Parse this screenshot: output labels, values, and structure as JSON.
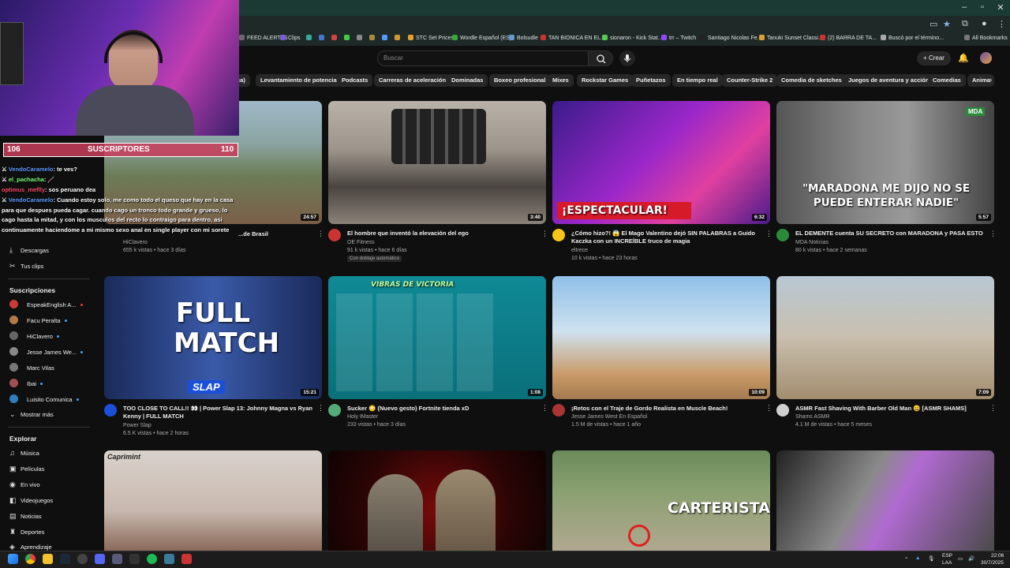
{
  "browser": {
    "bookmarks": [
      "FEED ALERTAS",
      "Clips",
      "STC Set Prices",
      "Wordle Español (ES)",
      "Bolsudle",
      "TAN BIONICA EN EL...",
      "sionaron - Kick Stat...",
      "trr – Twitch",
      "Santiago Nicolas Fe...",
      "Tanuki Sunset Classi...",
      "(2) BARRA DE TA...",
      "Buscó por el término...",
      "All Bookmarks"
    ]
  },
  "header": {
    "search_placeholder": "Buscar",
    "create_label": "Crear"
  },
  "chips": [
    "Levantamiento de potencia",
    "Podcasts",
    "Carreras de aceleración",
    "Dominadas",
    "Boxeo profesional",
    "Mixes",
    "Rockstar Games",
    "Puñetazos",
    "En tiempo real",
    "Counter-Strike 2",
    "Comedia de sketches",
    "Juegos de aventura y acción",
    "Comedias",
    "Anima"
  ],
  "sidebar": {
    "top_items": [
      {
        "label": "Descargas"
      },
      {
        "label": "Tus clips"
      }
    ],
    "subs_heading": "Suscripciones",
    "subs": [
      {
        "label": "EspeakEnglish A...",
        "color": "#c83a3a"
      },
      {
        "label": "Facu Peralta",
        "color": "#b07a4a"
      },
      {
        "label": "HiClavero",
        "color": "#666"
      },
      {
        "label": "Jesse James We...",
        "color": "#888"
      },
      {
        "label": "Marc Vilas",
        "color": "#777"
      },
      {
        "label": "Ibai",
        "color": "#a05050"
      },
      {
        "label": "Luisito Comunica",
        "color": "#2f7fbf"
      }
    ],
    "show_more": "Mostrar más",
    "explore_heading": "Explorar",
    "explore": [
      {
        "label": "Música",
        "icon": "♫"
      },
      {
        "label": "Películas",
        "icon": "▣"
      },
      {
        "label": "En vivo",
        "icon": "◉"
      },
      {
        "label": "Videojuegos",
        "icon": "◧"
      },
      {
        "label": "Noticias",
        "icon": "▤"
      },
      {
        "label": "Deportes",
        "icon": "♜"
      },
      {
        "label": "Aprendizaje",
        "icon": "◈"
      }
    ]
  },
  "videos": [
    {
      "title": "...de Brasil",
      "channel": "HiClavero",
      "meta": "655 k vistas • hace 3 días",
      "duration": "24:57"
    },
    {
      "title": "El hombre que inventó la elevación del ego",
      "channel": "OE Fitness",
      "meta": "91 k vistas • hace 6 días",
      "badge": "Con doblaje automático",
      "duration": "3:40"
    },
    {
      "title": "¿Cómo hizo?! 😱 El Mago Valentino dejó SIN PALABRAS a Guido Kaczka con un INCREÍBLE truco de magia",
      "channel": "eltrece",
      "meta": "10 k vistas • hace 23 horas",
      "duration": "6:32",
      "thumb_text": "¡ESPECTACULAR!"
    },
    {
      "title": "EL DEMENTE cuenta SU SECRETO con MARADONA y PASA ESTO",
      "channel": "MDA Noticias",
      "meta": "80 k vistas • hace 2 semanas",
      "duration": "5:57",
      "thumb_text": "\"MARADONA ME DIJO NO SE PUEDE ENTERAR NADIE\""
    },
    {
      "title": "TOO CLOSE TO CALL!! 👀 | Power Slap 13: Johnny Magna vs Ryan Kenny | FULL MATCH",
      "channel": "Power Slap",
      "meta": "6.5 K vistas • hace 2 horas",
      "duration": "15:21",
      "thumb_text": "FULL MATCH"
    },
    {
      "title": "Sucker 😳 (Nuevo gesto) Fortnite tienda xD",
      "channel": "Holy IMaster",
      "meta": "233 vistas • hace 3 días",
      "duration": "1:08",
      "thumb_text": "VIBRAS DE VICTORIA"
    },
    {
      "title": "¡Retos con el Traje de Gordo Realista en Muscle Beach!",
      "channel": "Jesse James West En Español",
      "meta": "1.5 M de vistas • hace 1 año",
      "duration": "10:09"
    },
    {
      "title": "ASMR Fast Shaving With Barber Old Man 😄 [ASMR SHAMS]",
      "channel": "Shams ASMR",
      "meta": "4.1 M de vistas • hace 5 meses",
      "duration": "7:09"
    },
    {
      "thumb_text": "CARTERISTA"
    }
  ],
  "stream": {
    "subs_left": "106",
    "subs_label": "SUSCRIPTORES",
    "subs_right": "110",
    "chat": [
      {
        "user": "VendoCaramelo",
        "msg": ": te ves?"
      },
      {
        "user": "el_pachacha",
        "msg": ": 🦯"
      },
      {
        "user": "optimus_meflly",
        "msg": ": sos peruano dea"
      },
      {
        "user": "VendoCaramelo",
        "msg": ": Cuando estoy solo, me como todo el queso que hay en la casa para que despues pueda cagar. cuando cago un tronco todo grande y grueso, lo cago hasta la mitad, y con los musculos del recto lo contraigo para dentro, asi continuamente haciendome a mi mismo sexo anal en single player con mi sorete"
      }
    ]
  },
  "taskbar": {
    "lang": "ESP",
    "lang2": "LAA",
    "time": "22:06",
    "date": "30/7/2025"
  }
}
